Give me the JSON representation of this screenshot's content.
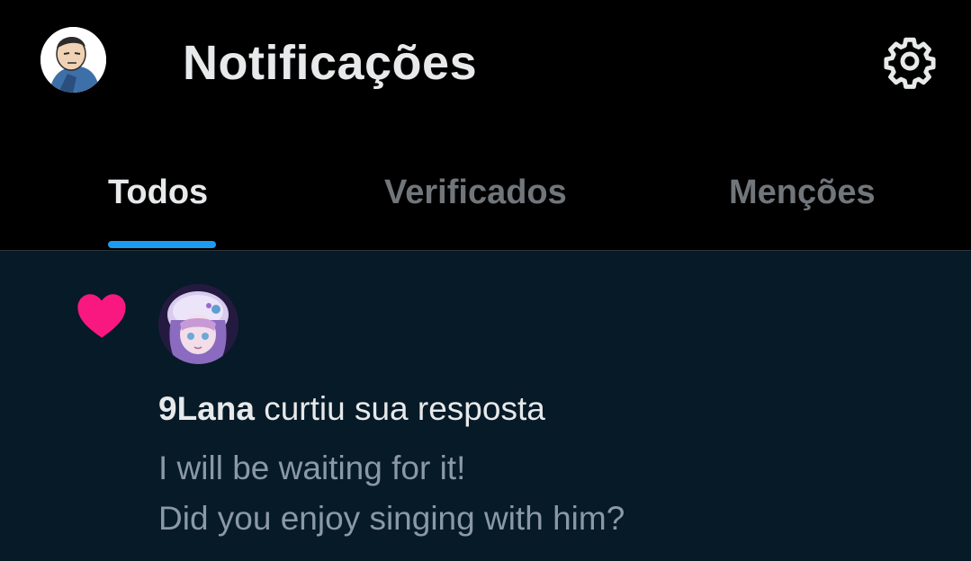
{
  "header": {
    "title": "Notificações",
    "profile_avatar_icon": "user-avatar-icon",
    "settings_icon": "gear-icon"
  },
  "tabs": [
    {
      "label": "Todos",
      "active": true
    },
    {
      "label": "Verificados",
      "active": false
    },
    {
      "label": "Menções",
      "active": false
    }
  ],
  "notification": {
    "type_icon": "heart-icon",
    "user_name": "9Lana",
    "action": "curtiu sua resposta",
    "text_lines": [
      "I will be waiting for it!",
      "Did you enjoy singing with him?"
    ]
  },
  "colors": {
    "background": "#000000",
    "notification_background": "#061a28",
    "accent": "#1d9bf0",
    "heart": "#f91880",
    "primary_text": "#e7e9ea",
    "secondary_text": "#71767b"
  }
}
